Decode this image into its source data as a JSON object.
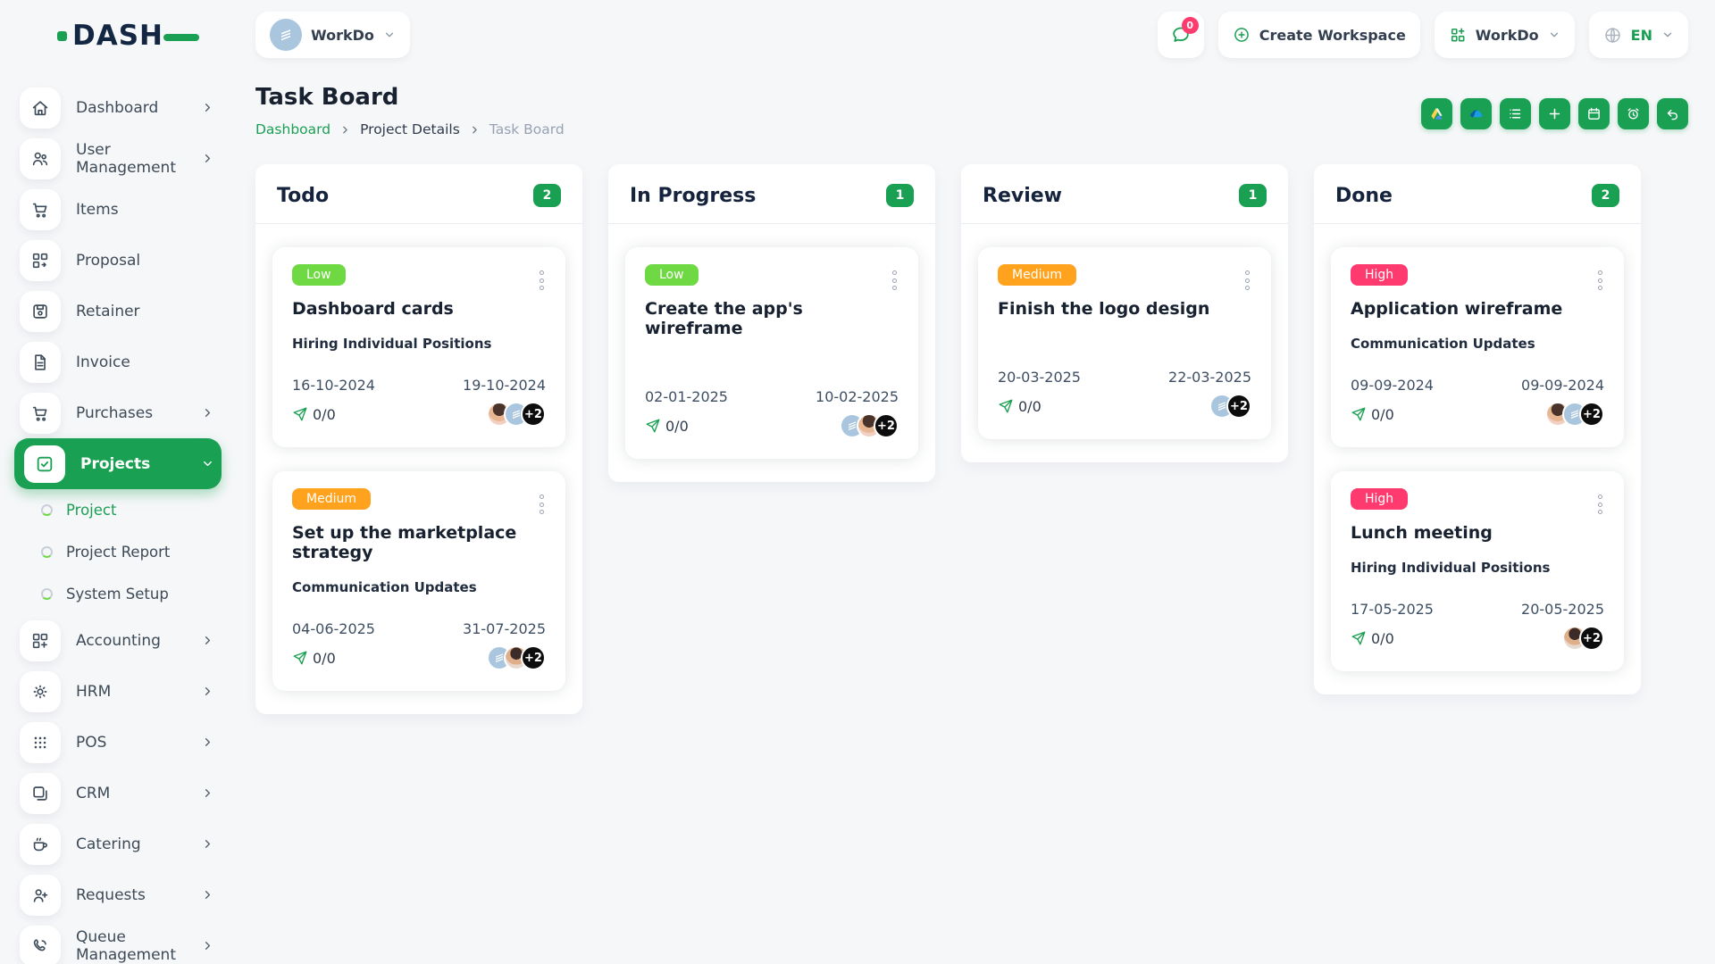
{
  "app": {
    "name": "DASH"
  },
  "topbar": {
    "workspace": {
      "label": "WorkDo"
    },
    "messages": {
      "badge": "0"
    },
    "create_workspace": {
      "label": "Create Workspace"
    },
    "app_menu": {
      "label": "WorkDo"
    },
    "language": {
      "code": "EN"
    }
  },
  "sidebar": {
    "items": [
      {
        "label": "Dashboard",
        "expandable": true
      },
      {
        "label": "User Management",
        "expandable": true
      },
      {
        "label": "Items",
        "expandable": false
      },
      {
        "label": "Proposal",
        "expandable": false
      },
      {
        "label": "Retainer",
        "expandable": false
      },
      {
        "label": "Invoice",
        "expandable": false
      },
      {
        "label": "Purchases",
        "expandable": true
      },
      {
        "label": "Projects",
        "expandable": true,
        "active": true,
        "expanded": true
      },
      {
        "label": "Accounting",
        "expandable": true
      },
      {
        "label": "HRM",
        "expandable": true
      },
      {
        "label": "POS",
        "expandable": true
      },
      {
        "label": "CRM",
        "expandable": true
      },
      {
        "label": "Catering",
        "expandable": true
      },
      {
        "label": "Requests",
        "expandable": true
      },
      {
        "label": "Queue Management",
        "expandable": true
      }
    ],
    "projects_children": [
      {
        "label": "Project",
        "active": true
      },
      {
        "label": "Project Report",
        "active": false
      },
      {
        "label": "System Setup",
        "active": false
      }
    ]
  },
  "page": {
    "title": "Task Board",
    "breadcrumb": [
      {
        "label": "Dashboard"
      },
      {
        "label": "Project Details"
      },
      {
        "label": "Task Board"
      }
    ]
  },
  "toolbar": {
    "buttons": [
      {
        "icon": "google-drive"
      },
      {
        "icon": "one-drive"
      },
      {
        "icon": "list"
      },
      {
        "icon": "add"
      },
      {
        "icon": "calendar"
      },
      {
        "icon": "timer"
      },
      {
        "icon": "undo"
      }
    ]
  },
  "board": {
    "columns": [
      {
        "title": "Todo",
        "count": "2",
        "cards": [
          {
            "priority": "Low",
            "title": "Dashboard cards",
            "description": "Hiring Individual Positions",
            "start_date": "16-10-2024",
            "end_date": "19-10-2024",
            "progress": "0/0",
            "extra_count": "+2",
            "avatars": [
              "photo",
              "company-logo",
              "overflow"
            ]
          },
          {
            "priority": "Medium",
            "title": "Set up the marketplace strategy",
            "description": "Communication Updates",
            "start_date": "04-06-2025",
            "end_date": "31-07-2025",
            "progress": "0/0",
            "extra_count": "+2",
            "avatars": [
              "company-logo",
              "photo",
              "overflow"
            ]
          }
        ]
      },
      {
        "title": "In Progress",
        "count": "1",
        "cards": [
          {
            "priority": "Low",
            "title": "Create the app's wireframe",
            "description": "",
            "start_date": "02-01-2025",
            "end_date": "10-02-2025",
            "progress": "0/0",
            "extra_count": "+2",
            "avatars": [
              "company-logo",
              "photo",
              "overflow"
            ]
          }
        ]
      },
      {
        "title": "Review",
        "count": "1",
        "cards": [
          {
            "priority": "Medium",
            "title": "Finish the logo design",
            "description": "",
            "start_date": "20-03-2025",
            "end_date": "22-03-2025",
            "progress": "0/0",
            "extra_count": "+2",
            "avatars": [
              "company-logo",
              "overflow"
            ]
          }
        ]
      },
      {
        "title": "Done",
        "count": "2",
        "cards": [
          {
            "priority": "High",
            "title": "Application wireframe",
            "description": "Communication Updates",
            "start_date": "09-09-2024",
            "end_date": "09-09-2024",
            "progress": "0/0",
            "extra_count": "+2",
            "avatars": [
              "photo",
              "company-logo",
              "overflow"
            ]
          },
          {
            "priority": "High",
            "title": "Lunch meeting",
            "description": "Hiring Individual Positions",
            "start_date": "17-05-2025",
            "end_date": "20-05-2025",
            "progress": "0/0",
            "extra_count": "+2",
            "avatars": [
              "photo",
              "overflow"
            ]
          }
        ]
      }
    ]
  },
  "colors": {
    "primary_green": "#1aa053",
    "priority_low": "#6fd943",
    "priority_medium": "#ffa21d",
    "priority_high": "#ff3a6e",
    "badge_pink": "#ff3a6e",
    "logo_navy": "#132743"
  }
}
